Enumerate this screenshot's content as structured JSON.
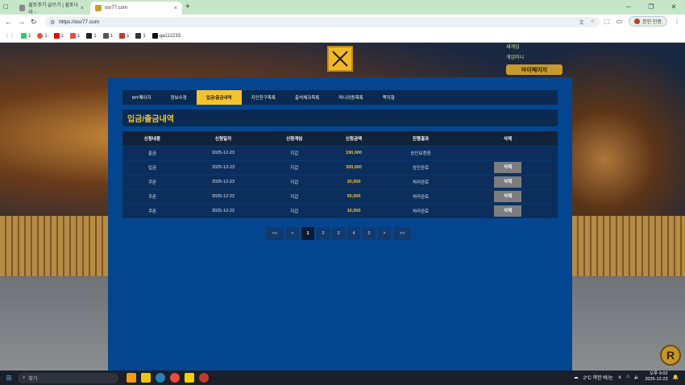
{
  "browser": {
    "tabs": [
      {
        "title": "쉴토주기 글쓰기 | 쉴토나라 -"
      },
      {
        "title": "osr77.com"
      }
    ],
    "url": "https://osr77.com",
    "profile_label": "본인 인증",
    "bookmarks": [
      "1",
      "1",
      "1",
      "1",
      "1",
      "1",
      "1",
      "1",
      "qa112233"
    ]
  },
  "site_bg": {
    "mypage_label": "마이페이지",
    "small_top": "새게임",
    "small_top2": "게임머니"
  },
  "modal": {
    "tabs": [
      {
        "label": "MY페이지"
      },
      {
        "label": "정보수정"
      },
      {
        "label": "입금/출금내역",
        "active": true
      },
      {
        "label": "지인친구목록"
      },
      {
        "label": "출석체크목록"
      },
      {
        "label": "머니이동목록"
      },
      {
        "label": "쪽지함"
      }
    ],
    "heading": "입금/출금내역",
    "columns": [
      "신청내용",
      "신청일자",
      "신청게임",
      "신청금액",
      "진행결과",
      "삭제"
    ],
    "rows": [
      {
        "type": "출금",
        "date": "2025-12-23",
        "game": "지갑",
        "amount": "190,000",
        "status": "승인요청중",
        "delete": ""
      },
      {
        "type": "입금",
        "date": "2025-12-23",
        "game": "지갑",
        "amount": "300,000",
        "status": "승인완료",
        "delete": "삭제"
      },
      {
        "type": "쿠폰",
        "date": "2025-12-23",
        "game": "지갑",
        "amount": "20,000",
        "status": "처리완료",
        "delete": "삭제"
      },
      {
        "type": "쿠폰",
        "date": "2025-12-22",
        "game": "지갑",
        "amount": "50,000",
        "status": "처리완료",
        "delete": "삭제"
      },
      {
        "type": "쿠폰",
        "date": "2025-12-22",
        "game": "지갑",
        "amount": "10,000",
        "status": "처리완료",
        "delete": "삭제"
      }
    ],
    "pager": {
      "first": "<<",
      "prev": "<",
      "pages": [
        "1",
        "2",
        "3",
        "4",
        "5"
      ],
      "current": "1",
      "next": ">",
      "last": ">>"
    }
  },
  "taskbar": {
    "search_placeholder": "찾기",
    "weather": "2°C 약한 비/눈",
    "time": "오후 9:02",
    "date": "2025-12-23"
  },
  "colors": {
    "accent": "#f4c430",
    "modal_bg": "#04458f",
    "header_bg": "#0b2a52"
  }
}
